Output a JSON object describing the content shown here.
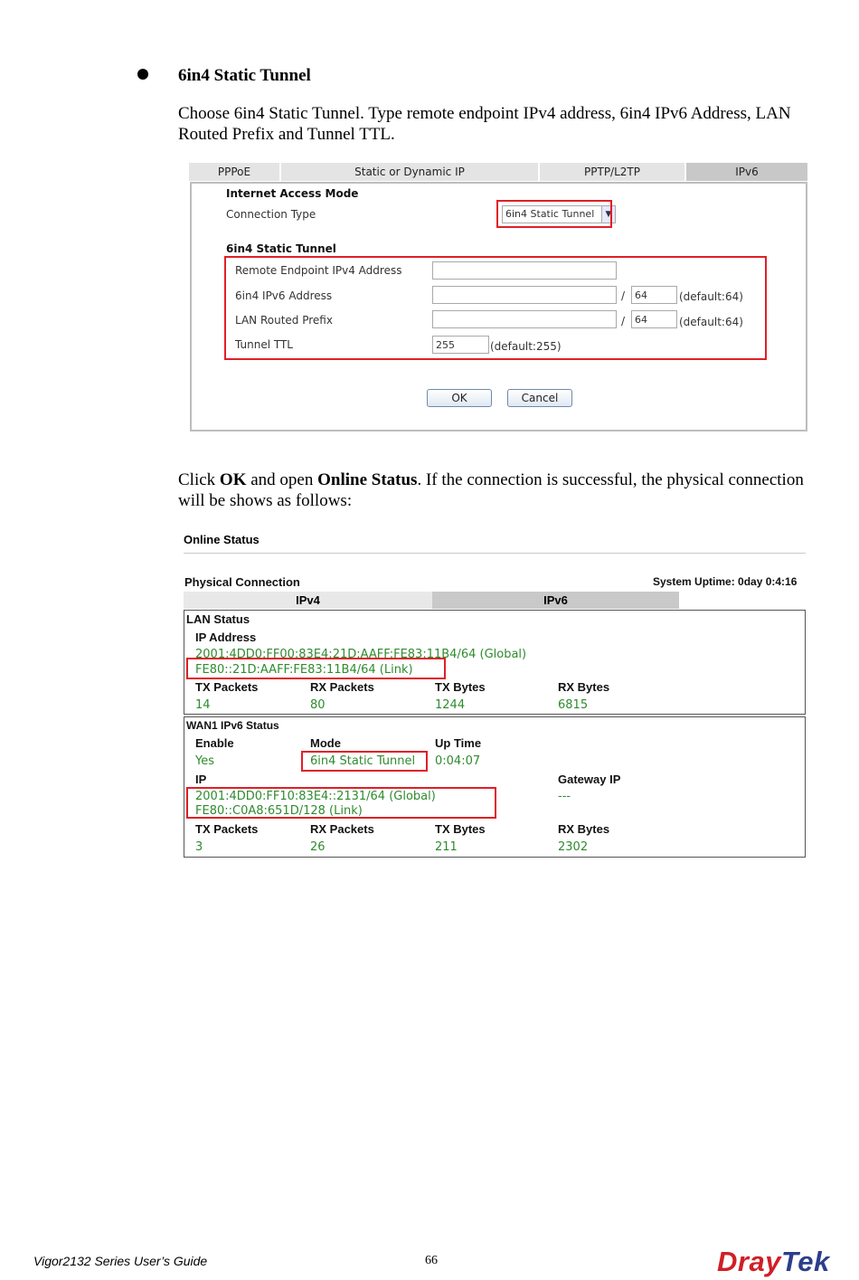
{
  "section": {
    "title": "6in4 Static Tunnel",
    "intro": "Choose 6in4 Static Tunnel. Type remote endpoint IPv4 address, 6in4 IPv6 Address, LAN Routed Prefix and Tunnel TTL.",
    "click_pre": "Click ",
    "click_ok": "OK",
    "click_mid": " and open ",
    "click_online": "Online Status",
    "click_post": ". If the connection is successful, the physical connection will be shows as follows:"
  },
  "config_screen": {
    "tabs": [
      "PPPoE",
      "Static or Dynamic IP",
      "PPTP/L2TP",
      "IPv6"
    ],
    "active_tab": "IPv6",
    "access_mode_heading": "Internet Access Mode",
    "connection_type_label": "Connection Type",
    "connection_type_value": "6in4 Static Tunnel",
    "tunnel_heading": "6in4 Static Tunnel",
    "remote_label": "Remote Endpoint IPv4 Address",
    "remote_value": "",
    "ipv6_label": "6in4 IPv6 Address",
    "ipv6_value": "",
    "ipv6_prefix": "64",
    "lan_label": "LAN Routed Prefix",
    "lan_value": "",
    "lan_prefix": "64",
    "slash": "/",
    "default64": "(default:64)",
    "ttl_label": "Tunnel TTL",
    "ttl_value": "255",
    "default255": "(default:255)",
    "ok_label": "OK",
    "cancel_label": "Cancel"
  },
  "online_status": {
    "title": "Online Status",
    "physical_connection": "Physical Connection",
    "uptime": "System Uptime: 0day 0:4:16",
    "tabs": [
      "IPv4",
      "IPv6"
    ],
    "lan": {
      "heading": "LAN Status",
      "ip_label": "IP Address",
      "ip_global": "2001:4DD0:FF00:83E4:21D:AAFF:FE83:11B4/64 (Global)",
      "ip_link": "FE80::21D:AAFF:FE83:11B4/64 (Link)",
      "headers": [
        "TX Packets",
        "RX Packets",
        "TX Bytes",
        "RX Bytes"
      ],
      "values": [
        "14",
        "80",
        "1244",
        "6815"
      ]
    },
    "wan": {
      "heading": "WAN1 IPv6 Status",
      "enable_label": "Enable",
      "mode_label": "Mode",
      "uptime_label": "Up Time",
      "enable_value": "Yes",
      "mode_value": "6in4 Static Tunnel",
      "uptime_value": "0:04:07",
      "ip_label": "IP",
      "gateway_label": "Gateway IP",
      "ip_global": "2001:4DD0:FF10:83E4::2131/64 (Global)",
      "ip_link": "FE80::C0A8:651D/128 (Link)",
      "gateway_value": "---",
      "headers": [
        "TX Packets",
        "RX Packets",
        "TX Bytes",
        "RX Bytes"
      ],
      "values": [
        "3",
        "26",
        "211",
        "2302"
      ]
    }
  },
  "footer": {
    "guide": "Vigor2132 Series User’s Guide",
    "page": "66",
    "logo_a": "Dray",
    "logo_b": "Tek"
  },
  "colors": {
    "highlight_red": "#e01f26",
    "status_green": "#2e8b2e",
    "logo_red": "#d01f26",
    "logo_blue": "#2b3e8c"
  }
}
